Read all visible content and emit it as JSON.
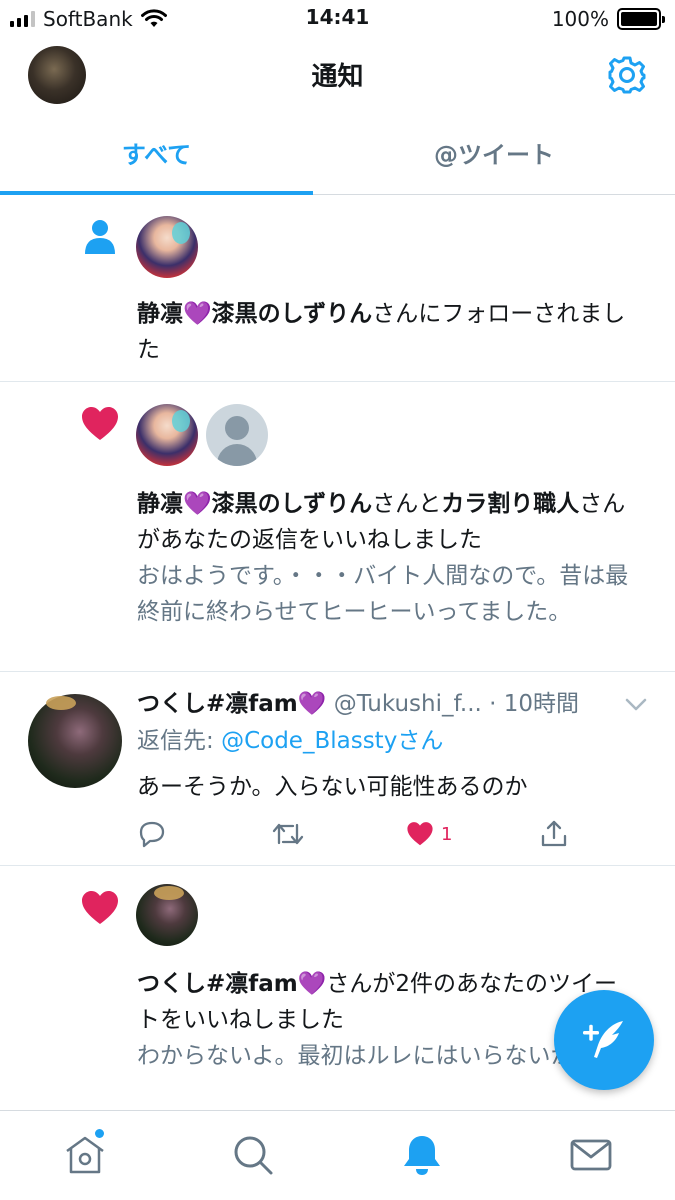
{
  "status_bar": {
    "carrier": "SoftBank",
    "time": "14:41",
    "battery": "100%"
  },
  "header": {
    "title": "通知"
  },
  "tabs": [
    {
      "label": "すべて",
      "active": true
    },
    {
      "label": "@ツイート",
      "active": false
    }
  ],
  "notifications": [
    {
      "type": "follow",
      "name": "静凛💜漆黒のしずりん",
      "action": "さんにフォローされました"
    },
    {
      "type": "like",
      "name1": "静凛💜漆黒のしずりん",
      "conj": "さんと",
      "name2": "カラ割り職人",
      "action": "さんがあなたの返信をいいねしました",
      "excerpt": "おはようです。・・・バイト人間なので。昔は最終前に終わらせてヒーヒーいってました。"
    },
    {
      "type": "tweet",
      "name": "つくし#凛fam💜",
      "handle": "@Tukushi_f...",
      "time": "· 10時間",
      "reply_label": "返信先: ",
      "reply_user": "@Code_Blassty",
      "reply_suffix": "さん",
      "body": "あーそうか。入らない可能性あるのか",
      "like_count": "1"
    },
    {
      "type": "like",
      "name": "つくし#凛fam💜",
      "action": "さんが2件のあなたのツイートをいいねしました",
      "excerpt": "わからないよ。最初はルレにはいらないかも。"
    }
  ],
  "colors": {
    "accent": "#1da1f2",
    "like": "#e0245e",
    "secondary_text": "#657786"
  },
  "icons": {
    "settings": "gear-icon",
    "follow": "person-icon",
    "like": "heart-icon",
    "compose": "compose-icon",
    "nav": [
      "home-icon",
      "search-icon",
      "bell-icon",
      "mail-icon"
    ]
  }
}
